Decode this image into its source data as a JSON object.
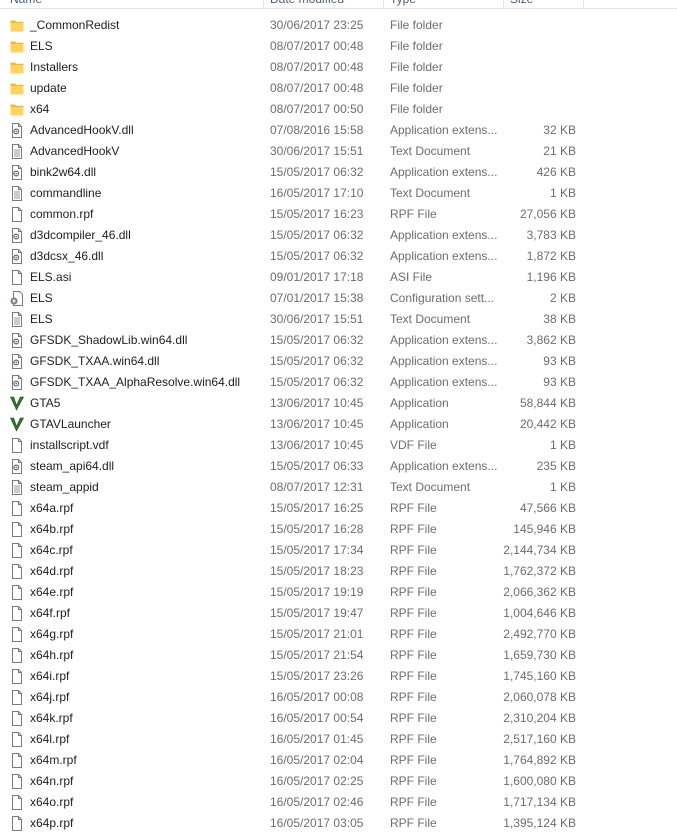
{
  "header": {
    "columns": [
      "Name",
      "Date modified",
      "Type",
      "Size"
    ]
  },
  "files": [
    {
      "name": "_CommonRedist",
      "date": "30/06/2017 23:25",
      "type": "File folder",
      "size": "",
      "icon": "folder-icon"
    },
    {
      "name": "ELS",
      "date": "08/07/2017 00:48",
      "type": "File folder",
      "size": "",
      "icon": "folder-icon"
    },
    {
      "name": "Installers",
      "date": "08/07/2017 00:48",
      "type": "File folder",
      "size": "",
      "icon": "folder-icon"
    },
    {
      "name": "update",
      "date": "08/07/2017 00:48",
      "type": "File folder",
      "size": "",
      "icon": "folder-icon"
    },
    {
      "name": "x64",
      "date": "08/07/2017 00:50",
      "type": "File folder",
      "size": "",
      "icon": "folder-icon"
    },
    {
      "name": "AdvancedHookV.dll",
      "date": "07/08/2016 15:58",
      "type": "Application extens...",
      "size": "32 KB",
      "icon": "dll-icon"
    },
    {
      "name": "AdvancedHookV",
      "date": "30/06/2017 15:51",
      "type": "Text Document",
      "size": "21 KB",
      "icon": "text-document-icon"
    },
    {
      "name": "bink2w64.dll",
      "date": "15/05/2017 06:32",
      "type": "Application extens...",
      "size": "426 KB",
      "icon": "dll-icon"
    },
    {
      "name": "commandline",
      "date": "16/05/2017 17:10",
      "type": "Text Document",
      "size": "1 KB",
      "icon": "text-document-icon"
    },
    {
      "name": "common.rpf",
      "date": "15/05/2017 16:23",
      "type": "RPF File",
      "size": "27,056 KB",
      "icon": "blank-file-icon"
    },
    {
      "name": "d3dcompiler_46.dll",
      "date": "15/05/2017 06:32",
      "type": "Application extens...",
      "size": "3,783 KB",
      "icon": "dll-icon"
    },
    {
      "name": "d3dcsx_46.dll",
      "date": "15/05/2017 06:32",
      "type": "Application extens...",
      "size": "1,872 KB",
      "icon": "dll-icon"
    },
    {
      "name": "ELS.asi",
      "date": "09/01/2017 17:18",
      "type": "ASI File",
      "size": "1,196 KB",
      "icon": "blank-file-icon"
    },
    {
      "name": "ELS",
      "date": "07/01/2017 15:38",
      "type": "Configuration sett...",
      "size": "2 KB",
      "icon": "config-file-icon"
    },
    {
      "name": "ELS",
      "date": "30/06/2017 15:51",
      "type": "Text Document",
      "size": "38 KB",
      "icon": "text-document-icon"
    },
    {
      "name": "GFSDK_ShadowLib.win64.dll",
      "date": "15/05/2017 06:32",
      "type": "Application extens...",
      "size": "3,862 KB",
      "icon": "dll-icon"
    },
    {
      "name": "GFSDK_TXAA.win64.dll",
      "date": "15/05/2017 06:32",
      "type": "Application extens...",
      "size": "93 KB",
      "icon": "dll-icon"
    },
    {
      "name": "GFSDK_TXAA_AlphaResolve.win64.dll",
      "date": "15/05/2017 06:32",
      "type": "Application extens...",
      "size": "93 KB",
      "icon": "dll-icon"
    },
    {
      "name": "GTA5",
      "date": "13/06/2017 10:45",
      "type": "Application",
      "size": "58,844 KB",
      "icon": "gta-v-app-icon"
    },
    {
      "name": "GTAVLauncher",
      "date": "13/06/2017 10:45",
      "type": "Application",
      "size": "20,442 KB",
      "icon": "gta-v-app-icon"
    },
    {
      "name": "installscript.vdf",
      "date": "13/06/2017 10:45",
      "type": "VDF File",
      "size": "1 KB",
      "icon": "blank-file-icon"
    },
    {
      "name": "steam_api64.dll",
      "date": "15/05/2017 06:33",
      "type": "Application extens...",
      "size": "235 KB",
      "icon": "dll-icon"
    },
    {
      "name": "steam_appid",
      "date": "08/07/2017 12:31",
      "type": "Text Document",
      "size": "1 KB",
      "icon": "text-document-icon"
    },
    {
      "name": "x64a.rpf",
      "date": "15/05/2017 16:25",
      "type": "RPF File",
      "size": "47,566 KB",
      "icon": "blank-file-icon"
    },
    {
      "name": "x64b.rpf",
      "date": "15/05/2017 16:28",
      "type": "RPF File",
      "size": "145,946 KB",
      "icon": "blank-file-icon"
    },
    {
      "name": "x64c.rpf",
      "date": "15/05/2017 17:34",
      "type": "RPF File",
      "size": "2,144,734 KB",
      "icon": "blank-file-icon"
    },
    {
      "name": "x64d.rpf",
      "date": "15/05/2017 18:23",
      "type": "RPF File",
      "size": "1,762,372 KB",
      "icon": "blank-file-icon"
    },
    {
      "name": "x64e.rpf",
      "date": "15/05/2017 19:19",
      "type": "RPF File",
      "size": "2,066,362 KB",
      "icon": "blank-file-icon"
    },
    {
      "name": "x64f.rpf",
      "date": "15/05/2017 19:47",
      "type": "RPF File",
      "size": "1,004,646 KB",
      "icon": "blank-file-icon"
    },
    {
      "name": "x64g.rpf",
      "date": "15/05/2017 21:01",
      "type": "RPF File",
      "size": "2,492,770 KB",
      "icon": "blank-file-icon"
    },
    {
      "name": "x64h.rpf",
      "date": "15/05/2017 21:54",
      "type": "RPF File",
      "size": "1,659,730 KB",
      "icon": "blank-file-icon"
    },
    {
      "name": "x64i.rpf",
      "date": "15/05/2017 23:26",
      "type": "RPF File",
      "size": "1,745,160 KB",
      "icon": "blank-file-icon"
    },
    {
      "name": "x64j.rpf",
      "date": "16/05/2017 00:08",
      "type": "RPF File",
      "size": "2,060,078 KB",
      "icon": "blank-file-icon"
    },
    {
      "name": "x64k.rpf",
      "date": "16/05/2017 00:54",
      "type": "RPF File",
      "size": "2,310,204 KB",
      "icon": "blank-file-icon"
    },
    {
      "name": "x64l.rpf",
      "date": "16/05/2017 01:45",
      "type": "RPF File",
      "size": "2,517,160 KB",
      "icon": "blank-file-icon"
    },
    {
      "name": "x64m.rpf",
      "date": "16/05/2017 02:04",
      "type": "RPF File",
      "size": "1,764,892 KB",
      "icon": "blank-file-icon"
    },
    {
      "name": "x64n.rpf",
      "date": "16/05/2017 02:25",
      "type": "RPF File",
      "size": "1,600,080 KB",
      "icon": "blank-file-icon"
    },
    {
      "name": "x64o.rpf",
      "date": "16/05/2017 02:46",
      "type": "RPF File",
      "size": "1,717,134 KB",
      "icon": "blank-file-icon"
    },
    {
      "name": "x64p.rpf",
      "date": "16/05/2017 03:05",
      "type": "RPF File",
      "size": "1,395,124 KB",
      "icon": "blank-file-icon"
    }
  ]
}
